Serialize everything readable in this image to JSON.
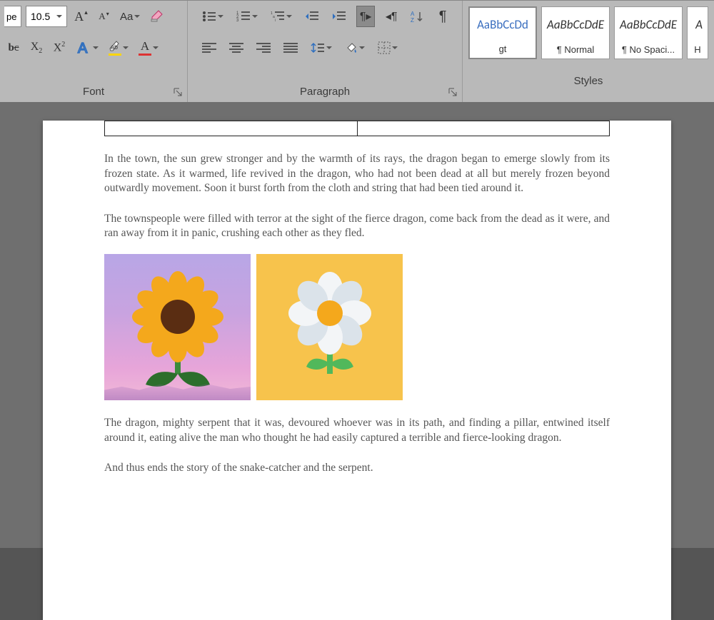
{
  "ribbon": {
    "font": {
      "label": "Font",
      "fontname_visible": "pe",
      "fontsize": "10.5",
      "subscript_prefix": "b",
      "btn_inc": "A",
      "btn_dec": "A",
      "btn_case": "Aa"
    },
    "paragraph": {
      "label": "Paragraph"
    },
    "styles": {
      "label": "Styles",
      "items": [
        {
          "preview": "AaBbCcDd",
          "name": "gt"
        },
        {
          "preview": "AaBbCcDdE",
          "name": "¶ Normal"
        },
        {
          "preview": "AaBbCcDdE",
          "name": "¶ No Spaci..."
        }
      ]
    }
  },
  "document": {
    "paragraphs": [
      "In the town, the sun grew stronger and by the warmth of its rays, the dragon began to emerge slowly from its frozen state. As it warmed, life revived in the dragon, who had not been dead at all but merely frozen beyond outwardly movement. Soon it burst forth from the cloth and string that had been tied around it.",
      "The townspeople were filled with terror at the sight of the fierce dragon, come back from the dead as it were, and ran away from it in panic, crushing each other as they fled.",
      "The dragon, mighty serpent that it was, devoured whoever was in its path, and finding a pillar, entwined itself around it, eating alive the man who thought he had easily captured a terrible and fierce-looking dragon.",
      "And thus ends the story of the snake-catcher and the serpent."
    ],
    "images": [
      {
        "name": "sunflower-on-purple"
      },
      {
        "name": "white-flower-on-yellow"
      }
    ]
  }
}
